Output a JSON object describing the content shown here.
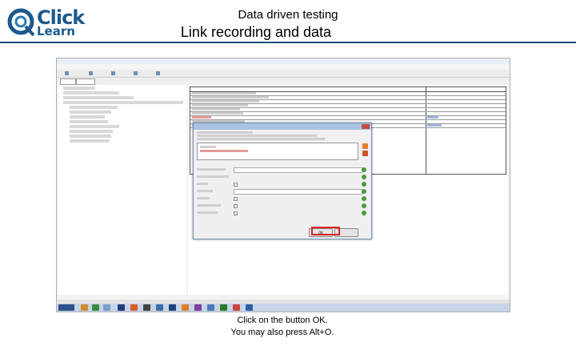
{
  "header": {
    "logo_top": "Click",
    "logo_bottom": "Learn",
    "title": "Data driven testing",
    "subtitle": "Link recording and data"
  },
  "caption": {
    "line1": "Click on the button OK.",
    "line2": "You may also press Alt+O."
  },
  "dialog": {
    "ok_label": "OK"
  },
  "colors": {
    "brand": "#1d5a8c",
    "highlight": "#e02020"
  }
}
